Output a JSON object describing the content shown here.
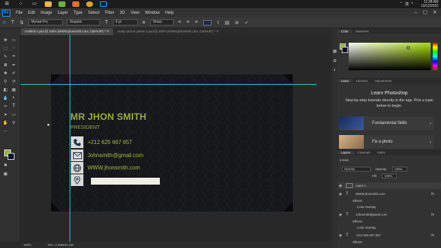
{
  "taskbar": {
    "time": "11:28 AM",
    "date": "10/12/2020"
  },
  "menubar": {
    "logo": "Ps",
    "items": [
      "File",
      "Edit",
      "Image",
      "Layer",
      "Type",
      "Select",
      "Filter",
      "3D",
      "View",
      "Window",
      "Help"
    ]
  },
  "options": {
    "font_family": "Myriad Pro",
    "font_style": "Regular",
    "font_size": "9 pt",
    "anti_alias": "Sharp"
  },
  "tabs": [
    {
      "label": "Untitled-1.psd @ 100% (WWW.jhonsmith.com, CMYK/8*) *"
    },
    {
      "label": "ready card er pelure 2.psd @ 100% (WWW.jhonsmith.com, CMYK/8*) *"
    }
  ],
  "card": {
    "name": "MR JHON SMITH",
    "title": "PRESIDENT",
    "phone": "+212 625 667 657",
    "email": "Johnsmith@gmail.com",
    "website": "WWW.jhonsmith.com"
  },
  "status": {
    "zoom": "100%",
    "doc": "Doc: 2.40M/14.4M"
  },
  "panels": {
    "color_tabs": [
      "Color",
      "Swatches"
    ],
    "learn_tabs": [
      "Learn",
      "Libraries",
      "Adjustments"
    ],
    "learn_title": "Learn Photoshop",
    "learn_desc": "Step-by-step tutorials directly in the app. Pick a topic below to begin.",
    "learn_items": [
      "Fundamental Skills",
      "Fix a photo"
    ],
    "layers_tabs": [
      "Layers",
      "Channels",
      "Paths"
    ],
    "blend_mode": "Normal",
    "opacity_label": "Opacity:",
    "opacity_value": "100%",
    "fill_label": "Fill:",
    "fill_value": "100%",
    "layers": [
      {
        "name": "Layer 1",
        "kind": "layer"
      },
      {
        "name": "WWW.jhonsmith.com",
        "kind": "text"
      },
      {
        "name": "Effects",
        "kind": "effects"
      },
      {
        "name": "Color Overlay",
        "kind": "effect"
      },
      {
        "name": "Johnsmith@gmail.com",
        "kind": "text"
      },
      {
        "name": "Effects",
        "kind": "effects"
      },
      {
        "name": "Color Overlay",
        "kind": "effect"
      },
      {
        "name": "+212 625 667 657",
        "kind": "text"
      },
      {
        "name": "Effects",
        "kind": "effects"
      }
    ]
  },
  "colors": {
    "accent_green": "#9aaa44",
    "card_bg": "#16171a",
    "guide": "#33c7d8",
    "foreground": "#8fb33a",
    "background": "#0e1226"
  }
}
